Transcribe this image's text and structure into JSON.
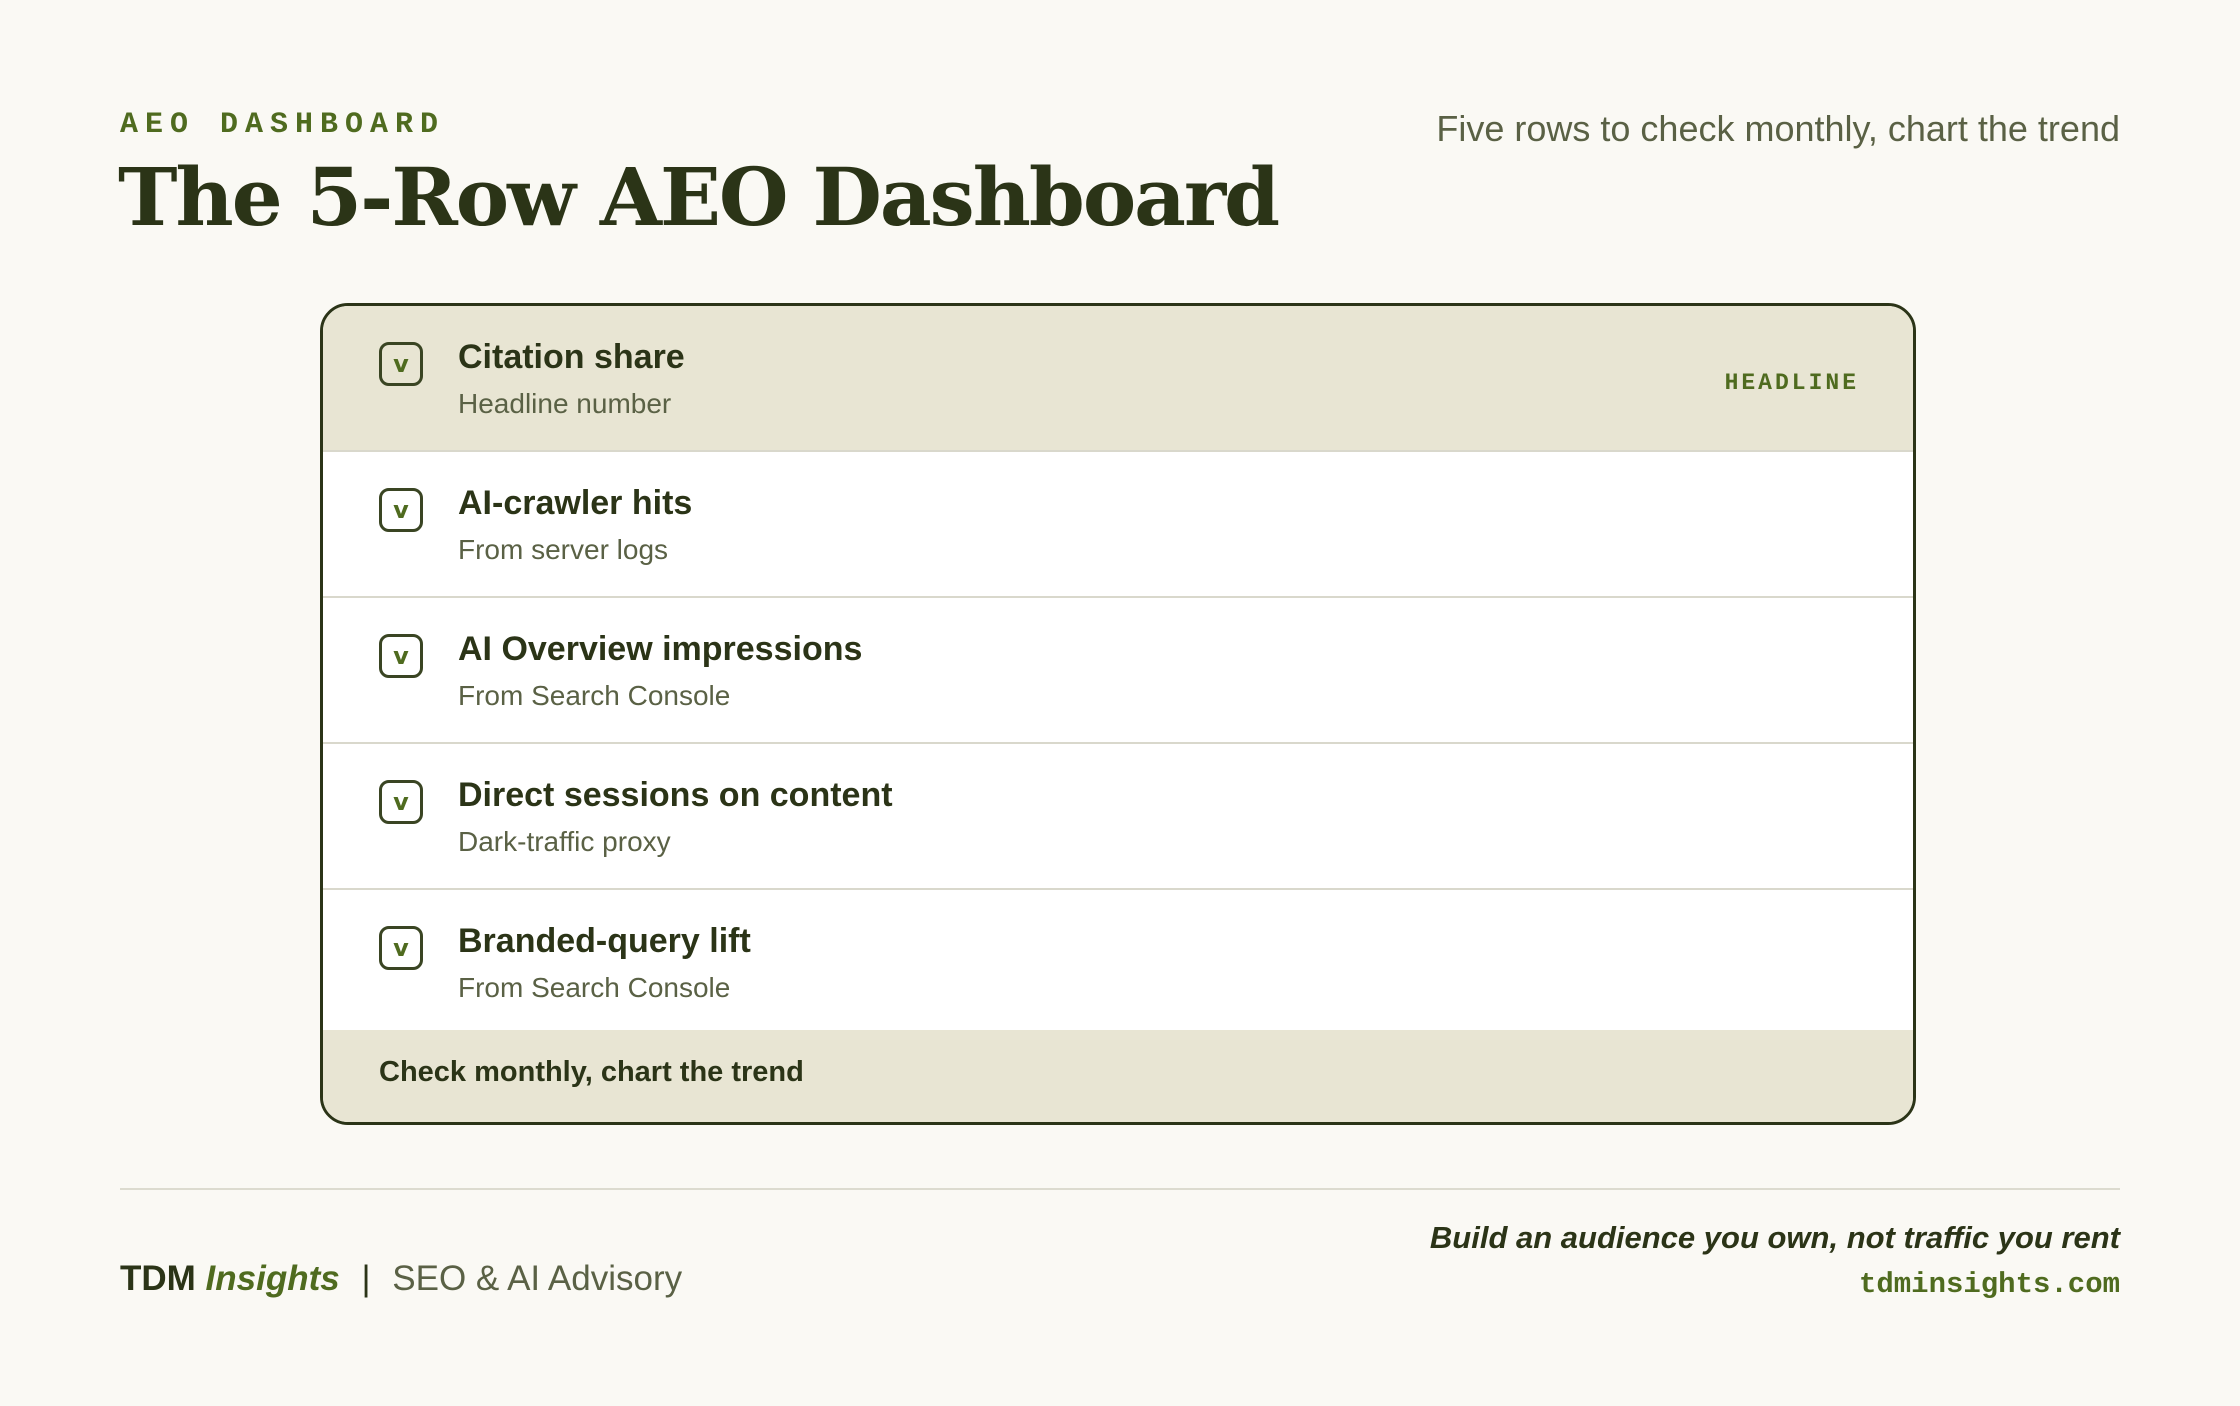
{
  "header": {
    "eyebrow": "AEO DASHBOARD",
    "title": "The 5-Row AEO Dashboard",
    "subtitle": "Five rows to check monthly, chart the trend"
  },
  "rows": [
    {
      "check": "v",
      "title": "Citation share",
      "subtitle": "Headline number",
      "tag": "HEADLINE"
    },
    {
      "check": "v",
      "title": "AI-crawler hits",
      "subtitle": "From server logs",
      "tag": ""
    },
    {
      "check": "v",
      "title": "AI Overview impressions",
      "subtitle": "From Search Console",
      "tag": ""
    },
    {
      "check": "v",
      "title": "Direct sessions on content",
      "subtitle": "Dark-traffic proxy",
      "tag": ""
    },
    {
      "check": "v",
      "title": "Branded-query lift",
      "subtitle": "From Search Console",
      "tag": ""
    }
  ],
  "card_footer": "Check monthly, chart the trend",
  "footer": {
    "brand_main": "TDM",
    "brand_accent": "Insights",
    "separator": "|",
    "brand_desc": "SEO & AI Advisory",
    "tagline": "Build an audience you own, not traffic you rent",
    "url": "tdminsights.com"
  },
  "colors": {
    "background": "#faf9f4",
    "text_dark": "#2b3417",
    "accent_green": "#4f6b1f",
    "muted": "#5a6145",
    "highlight_row": "#e8e5d3"
  }
}
